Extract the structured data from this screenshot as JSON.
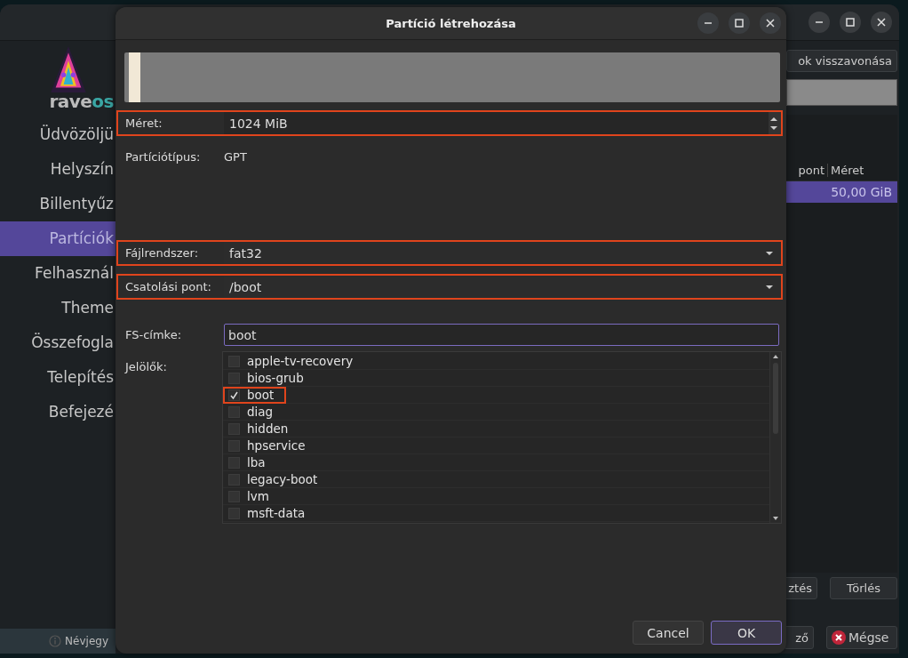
{
  "main_window": {
    "logo": {
      "text": "rave",
      "accent": "os"
    },
    "sidebar": {
      "items": [
        {
          "label": "Üdvözöljü",
          "selected": false
        },
        {
          "label": "Helyszín",
          "selected": false
        },
        {
          "label": "Billentyűz",
          "selected": false
        },
        {
          "label": "Partíciók",
          "selected": true
        },
        {
          "label": "Felhasznál",
          "selected": false
        },
        {
          "label": "Theme",
          "selected": false
        },
        {
          "label": "Összefogla",
          "selected": false
        },
        {
          "label": "Telepítés",
          "selected": false
        },
        {
          "label": "Befejezé",
          "selected": false
        }
      ],
      "about": "Névjegy"
    },
    "undo_button": "ok visszavonása",
    "table": {
      "columns": [
        "pont",
        "Méret"
      ],
      "rows": [
        {
          "cells": [
            "",
            "50,00 GiB"
          ],
          "selected": true
        }
      ]
    },
    "action_buttons": [
      "ztés",
      "Törlés"
    ],
    "nav_buttons": [
      {
        "label": "ző",
        "kind": "plain"
      },
      {
        "label": "Mégse",
        "kind": "cancel"
      }
    ]
  },
  "dialog": {
    "title": "Partíció létrehozása",
    "size": {
      "label": "Méret:",
      "value": "1024 MiB",
      "highlighted": true
    },
    "partition_type": {
      "label": "Partíciótípus:",
      "value": "GPT"
    },
    "filesystem": {
      "label": "Fájlrendszer:",
      "value": "fat32",
      "highlighted": true
    },
    "mount_point": {
      "label": "Csatolási pont:",
      "value": "/boot",
      "highlighted": true
    },
    "fs_label": {
      "label": "FS-címke:",
      "value": "boot"
    },
    "flags": {
      "label": "Jelölők:",
      "items": [
        {
          "label": "apple-tv-recovery",
          "checked": false,
          "highlighted": false
        },
        {
          "label": "bios-grub",
          "checked": false,
          "highlighted": false
        },
        {
          "label": "boot",
          "checked": true,
          "highlighted": true
        },
        {
          "label": "diag",
          "checked": false,
          "highlighted": false
        },
        {
          "label": "hidden",
          "checked": false,
          "highlighted": false
        },
        {
          "label": "hpservice",
          "checked": false,
          "highlighted": false
        },
        {
          "label": "lba",
          "checked": false,
          "highlighted": false
        },
        {
          "label": "legacy-boot",
          "checked": false,
          "highlighted": false
        },
        {
          "label": "lvm",
          "checked": false,
          "highlighted": false
        },
        {
          "label": "msft-data",
          "checked": false,
          "highlighted": false
        }
      ]
    },
    "buttons": [
      {
        "label": "Cancel",
        "focused": false
      },
      {
        "label": "OK",
        "focused": true
      }
    ]
  }
}
